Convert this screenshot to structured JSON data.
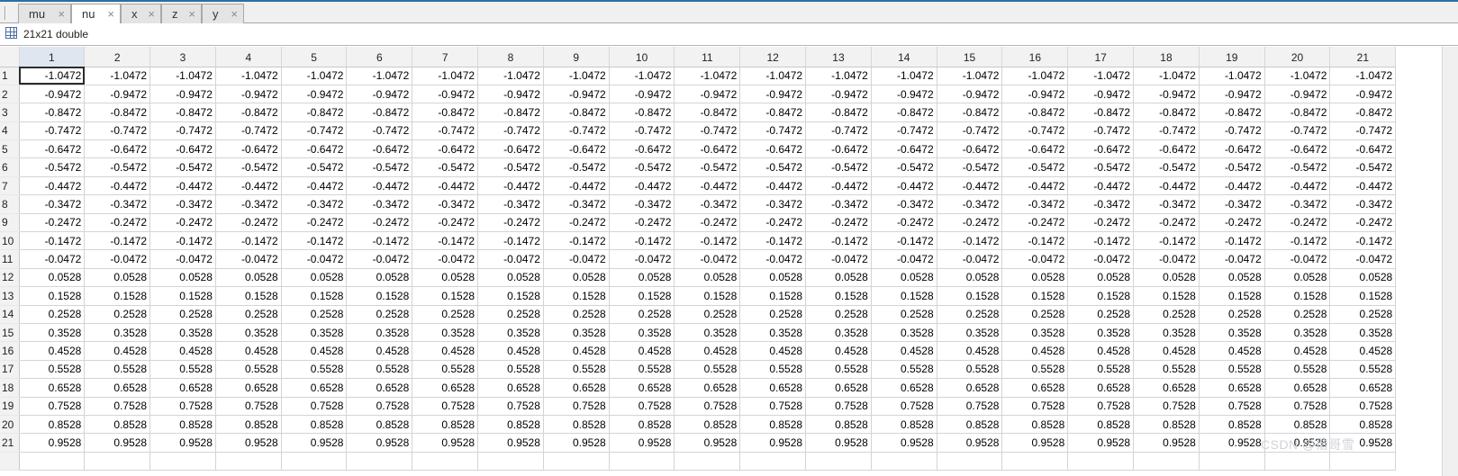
{
  "tabs": [
    {
      "label": "mu",
      "close": "×"
    },
    {
      "label": "nu",
      "close": "×"
    },
    {
      "label": "x",
      "close": "×"
    },
    {
      "label": "z",
      "close": "×"
    },
    {
      "label": "y",
      "close": "×"
    }
  ],
  "active_tab": "nu",
  "variable_info": "21x21 double",
  "table": {
    "column_headers": [
      "1",
      "2",
      "3",
      "4",
      "5",
      "6",
      "7",
      "8",
      "9",
      "10",
      "11",
      "12",
      "13",
      "14",
      "15",
      "16",
      "17",
      "18",
      "19",
      "20",
      "21"
    ],
    "row_headers": [
      "1",
      "2",
      "3",
      "4",
      "5",
      "6",
      "7",
      "8",
      "9",
      "10",
      "11",
      "12",
      "13",
      "14",
      "15",
      "16",
      "17",
      "18",
      "19",
      "20",
      "21"
    ],
    "row_values": [
      "-1.0472",
      "-0.9472",
      "-0.8472",
      "-0.7472",
      "-0.6472",
      "-0.5472",
      "-0.4472",
      "-0.3472",
      "-0.2472",
      "-0.1472",
      "-0.0472",
      "0.0528",
      "0.1528",
      "0.2528",
      "0.3528",
      "0.4528",
      "0.5528",
      "0.6528",
      "0.7528",
      "0.8528",
      "0.9528"
    ],
    "selected_cell": {
      "row": 1,
      "col": 1
    }
  },
  "watermark": "CSDN @楷哥雪"
}
